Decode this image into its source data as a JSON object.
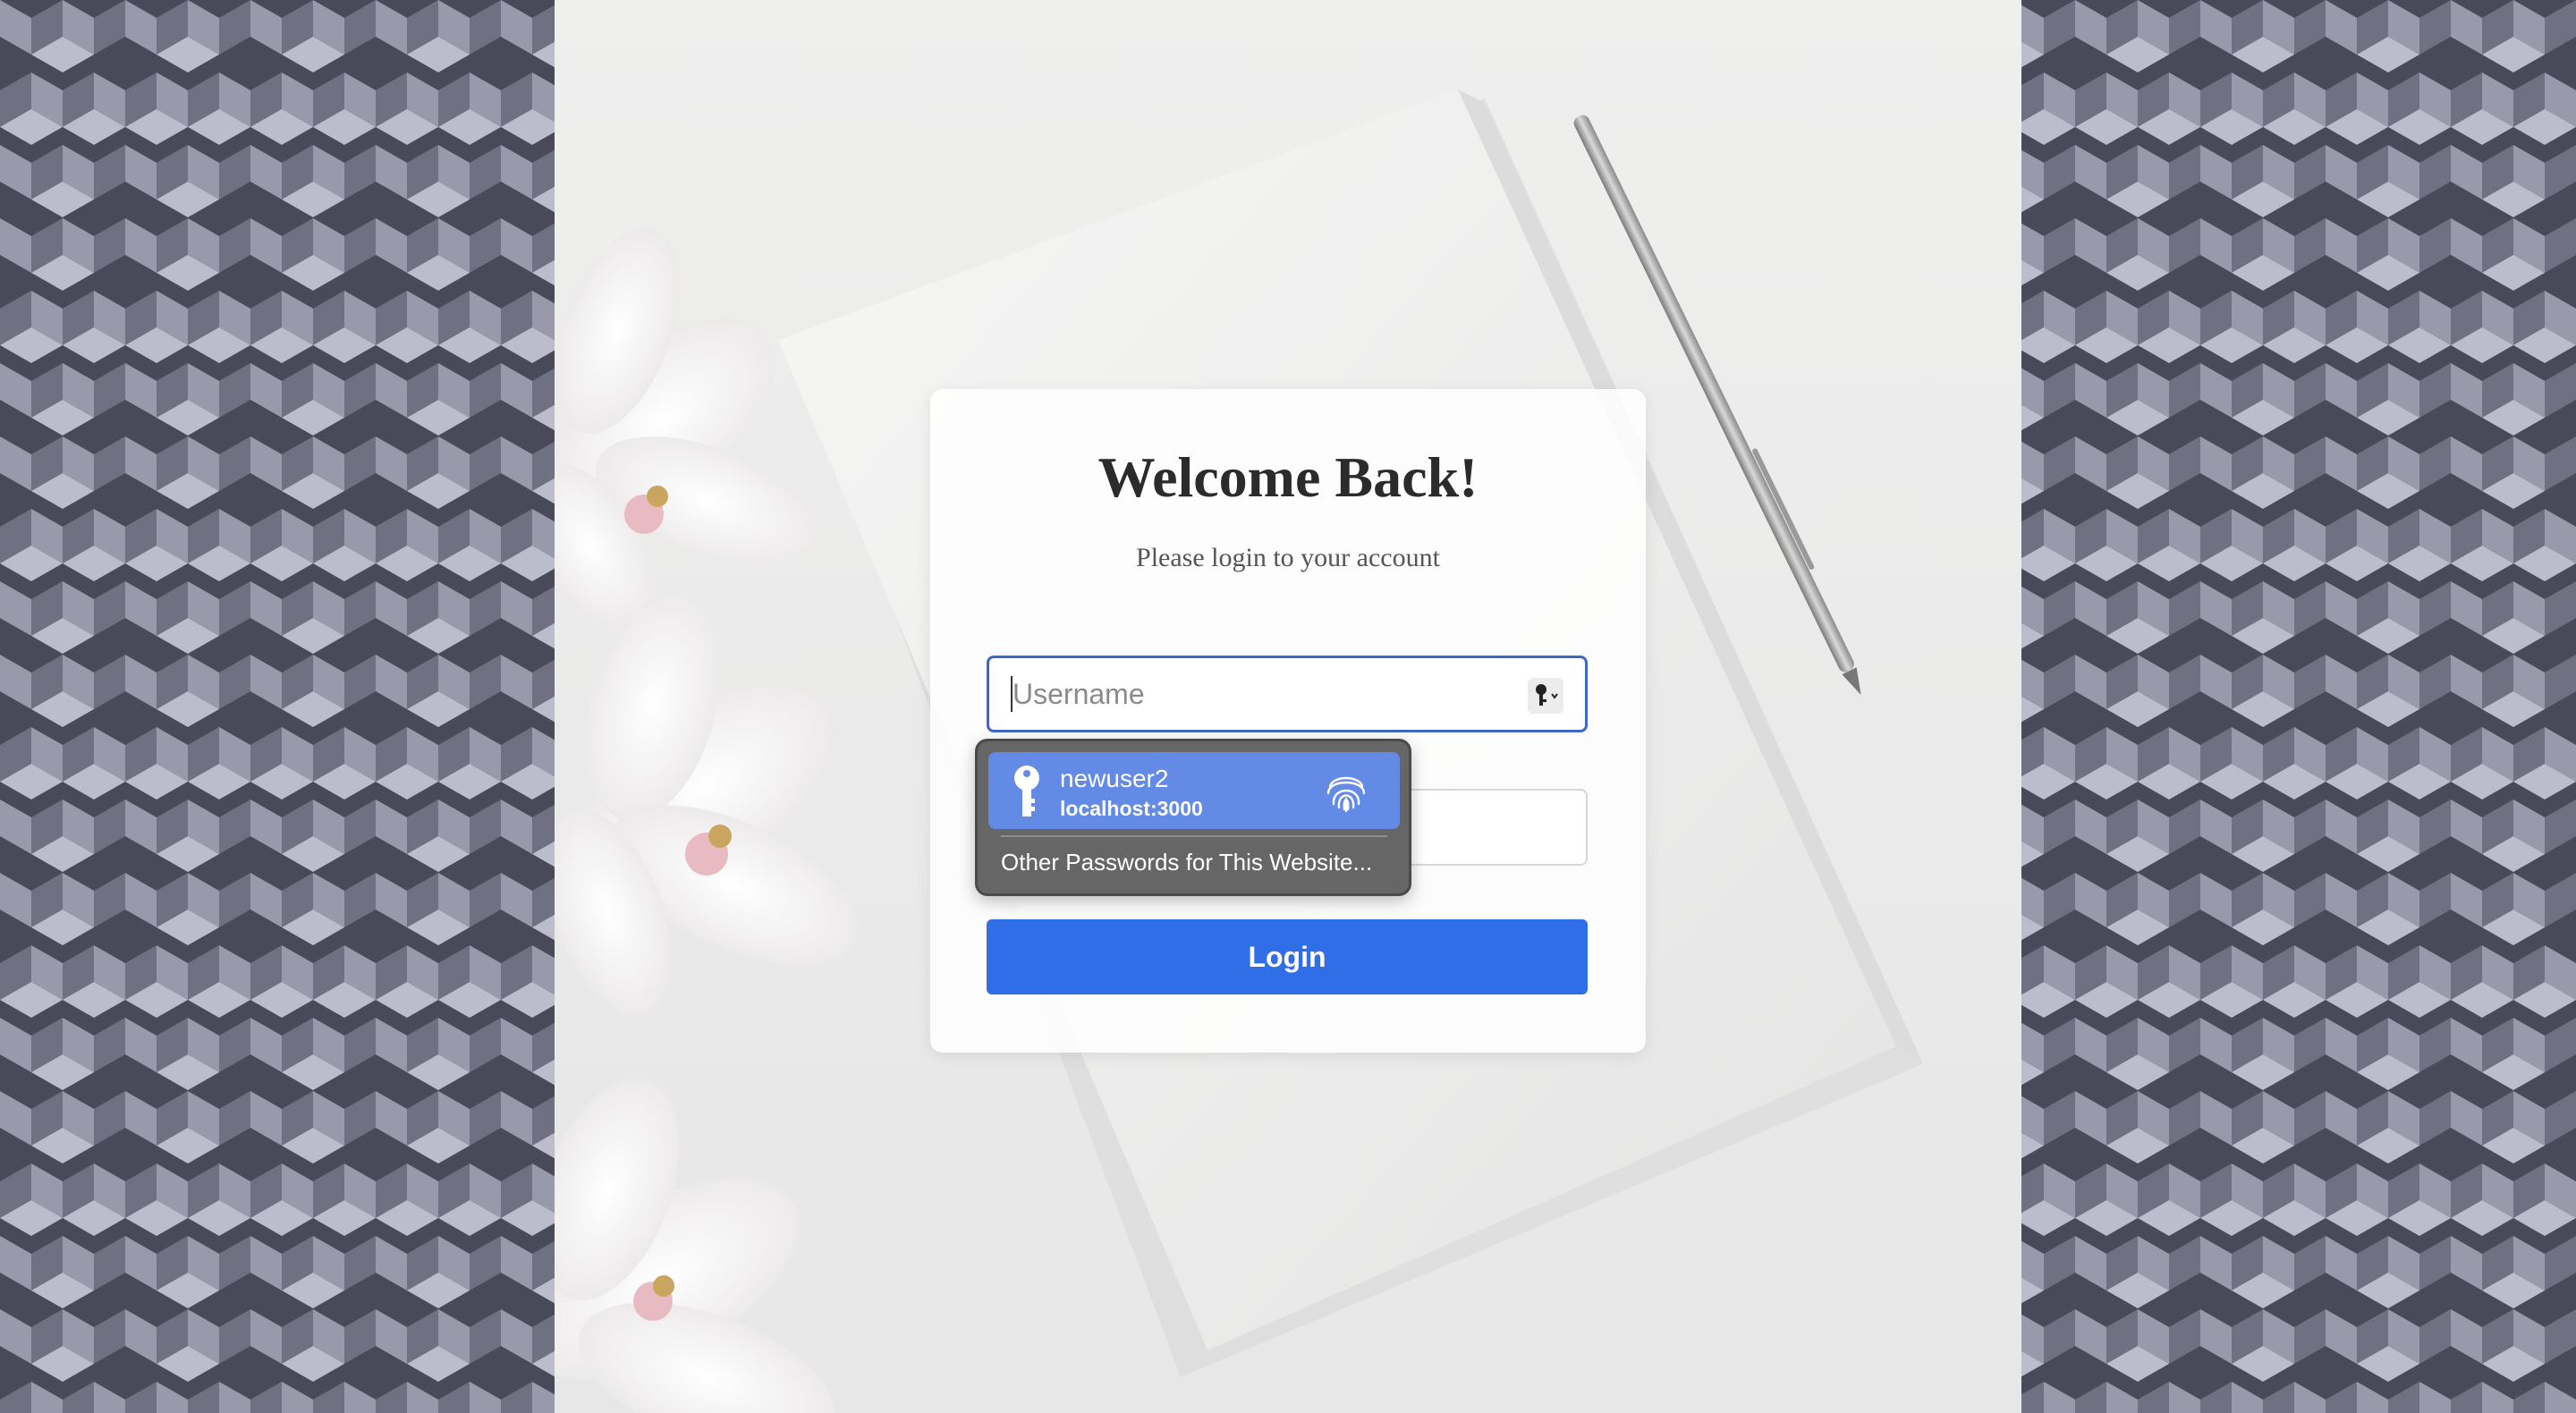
{
  "login_card": {
    "title": "Welcome Back!",
    "subtitle": "Please login to your account",
    "username_placeholder": "Username",
    "password_placeholder": "",
    "login_label": "Login"
  },
  "autofill_popup": {
    "saved_username": "newuser2",
    "saved_site": "localhost:3000",
    "other_passwords_label": "Other Passwords for This Website..."
  },
  "icons": {
    "autofill": "key-icon",
    "popup_key": "key-icon",
    "biometric": "fingerprint-icon"
  },
  "colors": {
    "login_button": "#2f6ee6",
    "username_focus_border": "#3d68c7",
    "popup_selected": "#638ae5",
    "popup_background": "#616161",
    "pattern_light": "#9a99ab",
    "pattern_mid": "#717083",
    "pattern_dark": "#494959"
  }
}
